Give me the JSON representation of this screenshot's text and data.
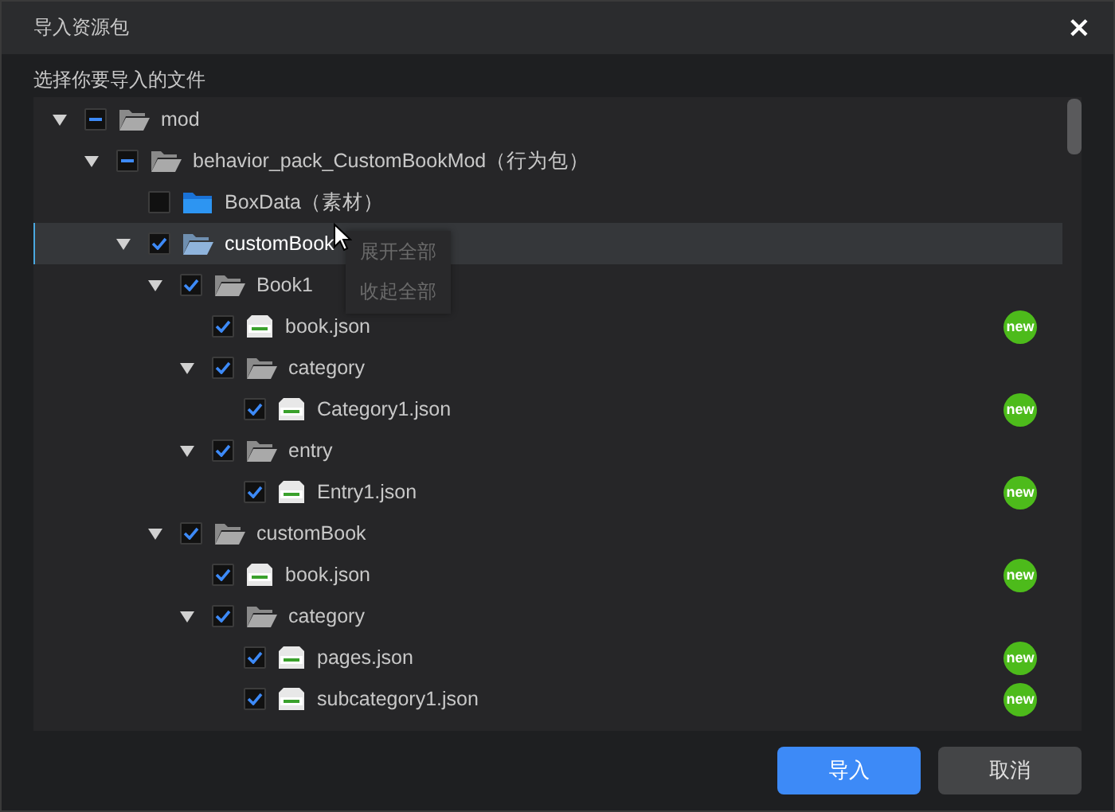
{
  "window": {
    "title": "导入资源包",
    "close": "×"
  },
  "prompt": "选择你要导入的文件",
  "tree": [
    {
      "label": "mod",
      "kind": "folder",
      "expanded": true,
      "partial": true,
      "selected": false,
      "children": [
        {
          "label": "behavior_pack_CustomBookMod（行为包）",
          "kind": "folder",
          "expanded": true,
          "partial": true,
          "selected": false,
          "children": [
            {
              "label": "BoxData（素材）",
              "kind": "folder_closed",
              "checked": false,
              "selected": false
            },
            {
              "label": "customBook",
              "kind": "folder",
              "expanded": true,
              "checked": true,
              "selected": true,
              "children": [
                {
                  "label": "Book1",
                  "kind": "folder",
                  "expanded": true,
                  "checked": true,
                  "selected": false,
                  "children": [
                    {
                      "label": "book.json",
                      "kind": "json",
                      "checked": true,
                      "selected": false,
                      "badge": "new"
                    },
                    {
                      "label": "category",
                      "kind": "folder",
                      "expanded": true,
                      "checked": true,
                      "selected": false,
                      "children": [
                        {
                          "label": "Category1.json",
                          "kind": "json",
                          "checked": true,
                          "selected": false,
                          "badge": "new"
                        }
                      ]
                    },
                    {
                      "label": "entry",
                      "kind": "folder",
                      "expanded": true,
                      "checked": true,
                      "selected": false,
                      "children": [
                        {
                          "label": "Entry1.json",
                          "kind": "json",
                          "checked": true,
                          "selected": false,
                          "badge": "new"
                        }
                      ]
                    }
                  ]
                },
                {
                  "label": "customBook",
                  "kind": "folder",
                  "expanded": true,
                  "checked": true,
                  "selected": false,
                  "children": [
                    {
                      "label": "book.json",
                      "kind": "json",
                      "checked": true,
                      "selected": false,
                      "badge": "new"
                    },
                    {
                      "label": "category",
                      "kind": "folder",
                      "expanded": true,
                      "checked": true,
                      "selected": false,
                      "children": [
                        {
                          "label": "pages.json",
                          "kind": "json",
                          "checked": true,
                          "selected": false,
                          "badge": "new"
                        },
                        {
                          "label": "subcategory1.json",
                          "kind": "json",
                          "checked": true,
                          "selected": false,
                          "badge": "new"
                        }
                      ]
                    }
                  ]
                }
              ]
            }
          ]
        }
      ]
    }
  ],
  "context_menu": {
    "items": [
      {
        "label": "展开全部",
        "disabled": true
      },
      {
        "label": "收起全部",
        "disabled": true
      }
    ]
  },
  "buttons": [
    {
      "label": "导入",
      "kind": "primary"
    },
    {
      "label": "取消",
      "kind": "secondary"
    }
  ]
}
